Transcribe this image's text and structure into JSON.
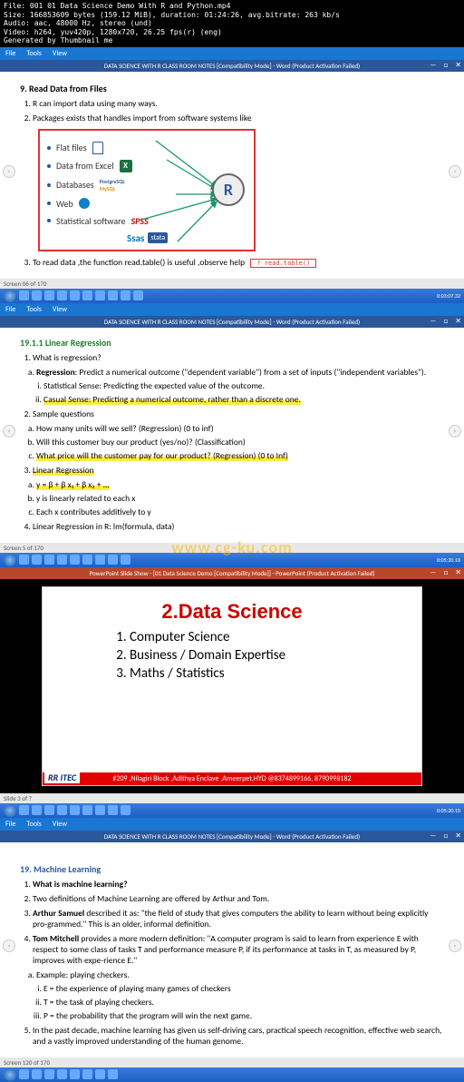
{
  "meta": {
    "file": "File: 001 01 Data Science Demo With R and Python.mp4",
    "size": "Size: 166853609 bytes (159.12 MiB), duration: 01:24:26, avg.bitrate: 263 kb/s",
    "audio": "Audio: aac, 48000 Hz, stereo (und)",
    "video": "Video: h264, yuv420p, 1280x720, 26.25 fps(r) (eng)",
    "gen": "Generated by Thumbnail me"
  },
  "menubar": {
    "file": "File",
    "tools": "Tools",
    "view": "View"
  },
  "wordtitle": "DATA SCIENCE WITH R CLASS ROOM NOTES [Compatibility Mode] - Word (Product Activation Failed)",
  "ppttitle": "PowerPoint Slide Show - [01 Data Science Demo [Compatibility Mode]] - PowerPoint (Product Activation Failed)",
  "pane1": {
    "heading": "9. Read Data from Files",
    "li1": "R can import data using many ways.",
    "li2": "Packages exists that handles import from software systems like",
    "box": {
      "flat": "Flat files",
      "excel": "Data from Excel",
      "db": "Databases",
      "pg": "PostgreSQL",
      "my": "MySQL",
      "web": "Web",
      "stat": "Statistical software",
      "spss": "SPSS",
      "sas": "Ssas",
      "stata": "stata",
      "r": "R"
    },
    "li3a": "To read data ,the function read.table() is useful ,observe help ",
    "li3b": "? read.table()"
  },
  "slidelabels": {
    "a": "Screen 06 of 170",
    "b": "Screen 5 of 170",
    "c": "Screen 120 of 170",
    "d": "Slide 3 of ?"
  },
  "times": {
    "a": "0:03:07.32",
    "b": "0:05:20.10",
    "c": "0:05:20.10",
    "d": ""
  },
  "pane2": {
    "heading": "19.1.1   Linear Regression",
    "q": "What is regression?",
    "a": "Regression",
    "a2": ": Predict a numerical outcome (\"dependent variable\") from a set of inputs (\"independent variables\").",
    "i1": "Statistical Sense: Predicting the expected value of the outcome.",
    "i2a": "Casual Sense",
    "i2b": ": Predicting a numerical outcome, rather than a discrete one.",
    "s": "Sample questions",
    "sa": "How many units will we sell? (Regression) (0 to inf)",
    "sb": "Will this customer buy our product (yes/no)? (Classification)",
    "sc": "What price will the customer pay for our product? (Regression) (0 to Inf)",
    "lr": "Linear Regression",
    "lra": "y = β + β x₁ + β x₂ + ...",
    "lrb": "y is linearly related to each x",
    "lrc": "Each x contributes additively to y",
    "lr4": "Linear Regression in R: lm(formula, data)"
  },
  "watermark": "www.cg-ku.com",
  "slide": {
    "title": "2.Data Science",
    "i1": "Computer Science",
    "i2": "Business / Domain Expertise",
    "i3": "Maths / Statistics",
    "banner": "#209 ,Nilagiri Block ,Adithya Enclave ,Ameerpet,HYD @8374899166, 8790998182",
    "itec": "RR ITEC"
  },
  "pane3": {
    "heading": "19.   Machine Learning",
    "q": "What is machine learning?",
    "t2": "Two definitions of Machine Learning are offered by Arthur and Tom.",
    "t3a": "Arthur Samuel",
    "t3b": " described it as: \"the field of study that gives computers the ability to learn without being explicitly pro-grammed.\" This is an older, informal definition.",
    "t4a": "Tom Mitchell",
    "t4b": " provides a more modern definition: \"A computer program is said to learn from experience E with respect to some class of tasks T and performance measure P, if its performance at tasks in T, as measured by P, improves with expe-rience E.\"",
    "ex": "Example: playing checkers.",
    "r1": "E = the experience of playing many games of checkers",
    "r2": "T = the task of playing checkers.",
    "r3": "P = the probability that the program will win the next game.",
    "t5": "In the past decade, machine learning has given us self-driving cars, practical speech recognition, effective web search, and a vastly improved understanding of the human genome."
  }
}
